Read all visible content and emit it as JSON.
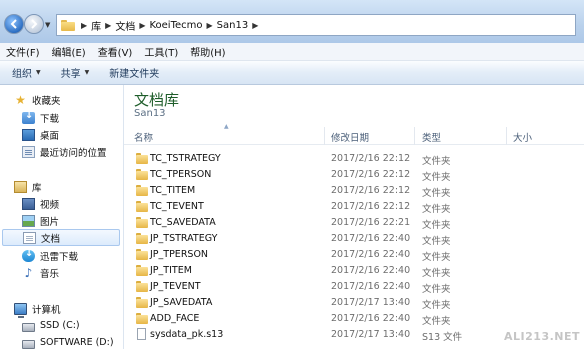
{
  "address": {
    "breadcrumbs": [
      "库",
      "文档",
      "KoeiTecmo",
      "San13"
    ]
  },
  "menu": [
    "文件(F)",
    "编辑(E)",
    "查看(V)",
    "工具(T)",
    "帮助(H)"
  ],
  "toolbar": {
    "organize": "组织",
    "share": "共享",
    "new_folder": "新建文件夹"
  },
  "nav": {
    "favorites": {
      "label": "收藏夹",
      "items": [
        "下载",
        "桌面",
        "最近访问的位置"
      ]
    },
    "libraries": {
      "label": "库",
      "items": [
        "视频",
        "图片",
        "文档",
        "迅雷下载",
        "音乐"
      ]
    },
    "computer": {
      "label": "计算机",
      "items": [
        "SSD (C:)",
        "SOFTWARE (D:)"
      ]
    }
  },
  "content": {
    "title": "文档库",
    "subtitle": "San13",
    "columns": {
      "name": "名称",
      "date": "修改日期",
      "type": "类型",
      "size": "大小"
    },
    "files": [
      {
        "name": "TC_TSTRATEGY",
        "date": "2017/2/16 22:12",
        "type": "文件夹",
        "kind": "folder"
      },
      {
        "name": "TC_TPERSON",
        "date": "2017/2/16 22:12",
        "type": "文件夹",
        "kind": "folder"
      },
      {
        "name": "TC_TITEM",
        "date": "2017/2/16 22:12",
        "type": "文件夹",
        "kind": "folder"
      },
      {
        "name": "TC_TEVENT",
        "date": "2017/2/16 22:12",
        "type": "文件夹",
        "kind": "folder"
      },
      {
        "name": "TC_SAVEDATA",
        "date": "2017/2/16 22:21",
        "type": "文件夹",
        "kind": "folder"
      },
      {
        "name": "JP_TSTRATEGY",
        "date": "2017/2/16 22:40",
        "type": "文件夹",
        "kind": "folder"
      },
      {
        "name": "JP_TPERSON",
        "date": "2017/2/16 22:40",
        "type": "文件夹",
        "kind": "folder"
      },
      {
        "name": "JP_TITEM",
        "date": "2017/2/16 22:40",
        "type": "文件夹",
        "kind": "folder"
      },
      {
        "name": "JP_TEVENT",
        "date": "2017/2/16 22:40",
        "type": "文件夹",
        "kind": "folder"
      },
      {
        "name": "JP_SAVEDATA",
        "date": "2017/2/17 13:40",
        "type": "文件夹",
        "kind": "folder"
      },
      {
        "name": "ADD_FACE",
        "date": "2017/2/16 22:40",
        "type": "文件夹",
        "kind": "folder"
      },
      {
        "name": "sysdata_pk.s13",
        "date": "2017/2/17 13:40",
        "type": "S13 文件",
        "kind": "file"
      }
    ]
  },
  "watermark": "ALI213.NET"
}
